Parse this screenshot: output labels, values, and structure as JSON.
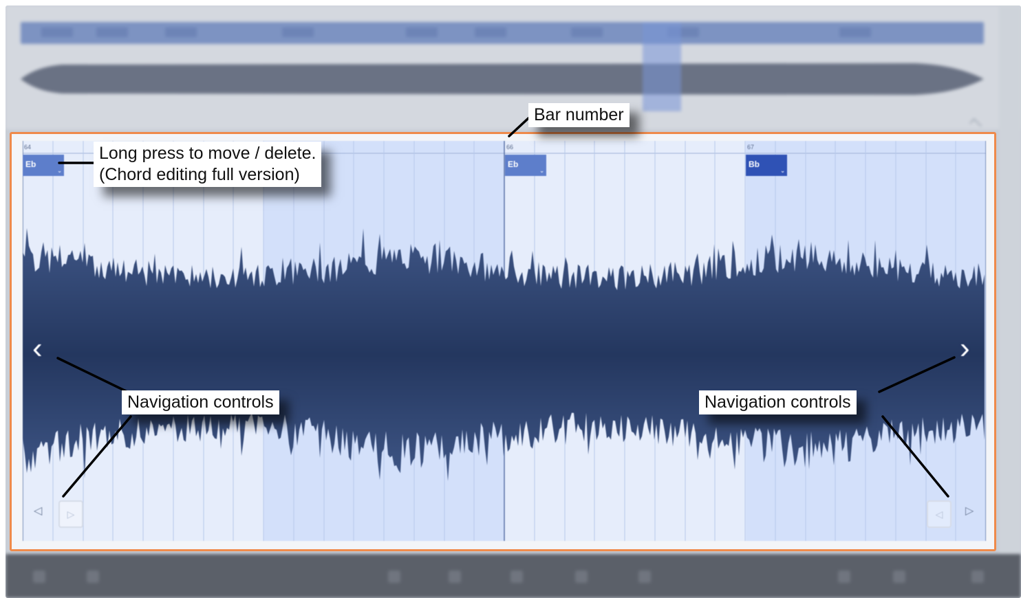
{
  "annotations": {
    "bar_number": "Bar number",
    "long_press_line1": "Long press to move / delete.",
    "long_press_line2": "(Chord editing full version)",
    "nav_left": "Navigation  controls",
    "nav_right": "Navigation  controls"
  },
  "timeline": {
    "bars": [
      "64",
      "66",
      "67"
    ]
  },
  "chords": [
    {
      "label": "Eb",
      "bar": "64"
    },
    {
      "label": "Eb",
      "bar": "66"
    },
    {
      "label": "Bb",
      "bar": "67"
    }
  ],
  "icons": {
    "prev_page": "chevron-left-icon",
    "next_page": "chevron-right-icon",
    "step_back": "triangle-left-icon",
    "step_forward": "triangle-right-icon",
    "chord_menu": "chevron-down-icon"
  },
  "colors": {
    "highlight_border": "#ef8a4a",
    "waveform": "#3f5686",
    "chord_chip": "#5d7ecb",
    "chord_chip_selected": "#2f52b5",
    "region_background": "#e6edfb"
  }
}
